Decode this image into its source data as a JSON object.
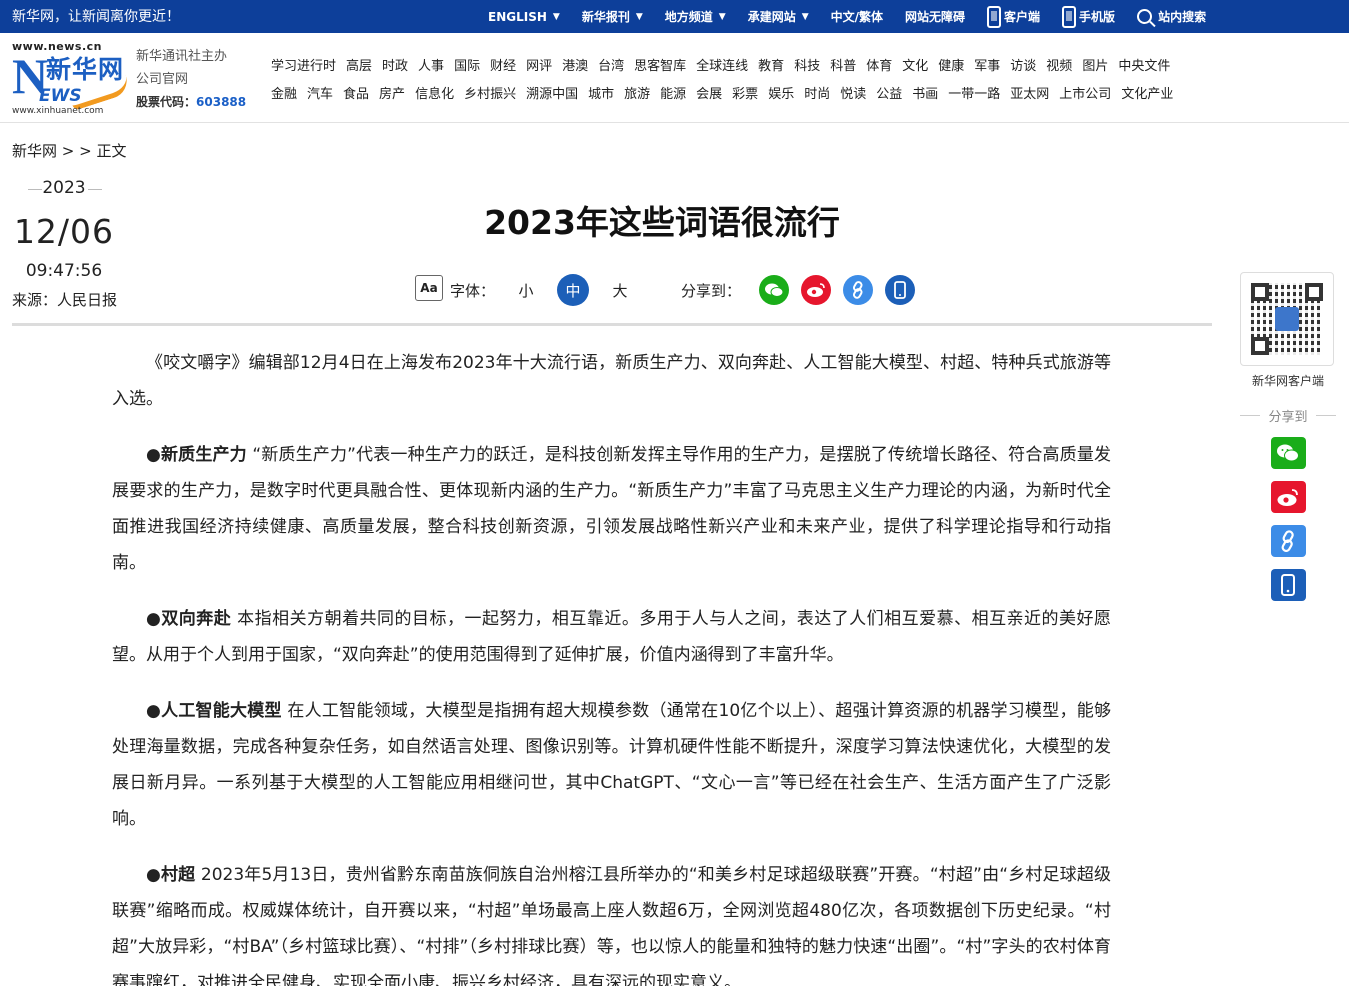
{
  "topbar": {
    "slogan": "新华网，让新闻离你更近！",
    "links": [
      {
        "label": "ENGLISH",
        "dropdown": true
      },
      {
        "label": "新华报刊",
        "dropdown": true
      },
      {
        "label": "地方频道",
        "dropdown": true
      },
      {
        "label": "承建网站",
        "dropdown": true
      },
      {
        "label": "中文/繁体",
        "dropdown": false
      },
      {
        "label": "网站无障碍",
        "dropdown": false
      }
    ],
    "client": "客户端",
    "mobile": "手机版",
    "search": "站内搜索"
  },
  "logo": {
    "url_top": "www.news.cn",
    "big_n": "N",
    "cn": "新华网",
    "ews": "EWS",
    "url_bottom": "www.xinhuanet.com"
  },
  "sponsor": {
    "line1": "新华通讯社主办",
    "line2": "公司官网",
    "stock_label": "股票代码：",
    "stock_code": "603888"
  },
  "nav": {
    "row1": [
      "学习进行时",
      "高层",
      "时政",
      "人事",
      "国际",
      "财经",
      "网评",
      "港澳",
      "台湾",
      "思客智库",
      "全球连线",
      "教育",
      "科技",
      "科普",
      "体育",
      "文化",
      "健康",
      "军事",
      "访谈",
      "视频",
      "图片",
      "中央文件"
    ],
    "row2": [
      "金融",
      "汽车",
      "食品",
      "房产",
      "信息化",
      "乡村振兴",
      "溯源中国",
      "城市",
      "旅游",
      "能源",
      "会展",
      "彩票",
      "娱乐",
      "时尚",
      "悦读",
      "公益",
      "书画",
      "一带一路",
      "亚太网",
      "上市公司",
      "文化产业"
    ]
  },
  "breadcrumb": "新华网 > > 正文",
  "meta": {
    "year": "2023",
    "date": "12/06",
    "time": "09:47:56",
    "source": "来源：人民日报"
  },
  "article": {
    "title": "2023年这些词语很流行",
    "font_icon": "Aa",
    "font_label": "字体：",
    "font_sizes": [
      "小",
      "中",
      "大"
    ],
    "share_label": "分享到：",
    "paragraphs": [
      {
        "head": "",
        "text": "《咬文嚼字》编辑部12月4日在上海发布2023年十大流行语，新质生产力、双向奔赴、人工智能大模型、村超、特种兵式旅游等入选。"
      },
      {
        "head": "●新质生产力",
        "text": " “新质生产力”代表一种生产力的跃迁，是科技创新发挥主导作用的生产力，是摆脱了传统增长路径、符合高质量发展要求的生产力，是数字时代更具融合性、更体现新内涵的生产力。“新质生产力”丰富了马克思主义生产力理论的内涵，为新时代全面推进我国经济持续健康、高质量发展，整合科技创新资源，引领发展战略性新兴产业和未来产业，提供了科学理论指导和行动指南。"
      },
      {
        "head": "●双向奔赴",
        "text": " 本指相关方朝着共同的目标，一起努力，相互靠近。多用于人与人之间，表达了人们相互爱慕、相互亲近的美好愿望。从用于个人到用于国家，“双向奔赴”的使用范围得到了延伸扩展，价值内涵得到了丰富升华。"
      },
      {
        "head": "●人工智能大模型",
        "text": " 在人工智能领域，大模型是指拥有超大规模参数（通常在10亿个以上）、超强计算资源的机器学习模型，能够处理海量数据，完成各种复杂任务，如自然语言处理、图像识别等。计算机硬件性能不断提升，深度学习算法快速优化，大模型的发展日新月异。一系列基于大模型的人工智能应用相继问世，其中ChatGPT、“文心一言”等已经在社会生产、生活方面产生了广泛影响。"
      },
      {
        "head": "●村超",
        "text": " 2023年5月13日，贵州省黔东南苗族侗族自治州榕江县所举办的“和美乡村足球超级联赛”开赛。“村超”由“乡村足球超级联赛”缩略而成。权威媒体统计，自开赛以来，“村超”单场最高上座人数超6万，全网浏览超480亿次，各项数据创下历史纪录。“村超”大放异彩，“村BA”（乡村篮球比赛）、“村排”（乡村排球比赛）等，也以惊人的能量和独特的魅力快速“出圈”。“村”字头的农村体育赛事蹿红，对推进全民健身、实现全面小康、振兴乡村经济，具有深远的现实意义。"
      }
    ]
  },
  "rightfloat": {
    "qr_label": "新华网客户端",
    "share_label": "分享到"
  },
  "colors": {
    "topbar": "#0d3f9a",
    "accent": "#1c5fb8",
    "wechat": "#1aad19",
    "weibo": "#e6162d",
    "link": "#3c8ce7"
  },
  "icons": [
    "client-phone-icon",
    "mobile-phone-icon",
    "search-icon",
    "font-size-icon",
    "wechat-icon",
    "weibo-icon",
    "link-icon",
    "mobile-icon",
    "qr-code-icon"
  ]
}
